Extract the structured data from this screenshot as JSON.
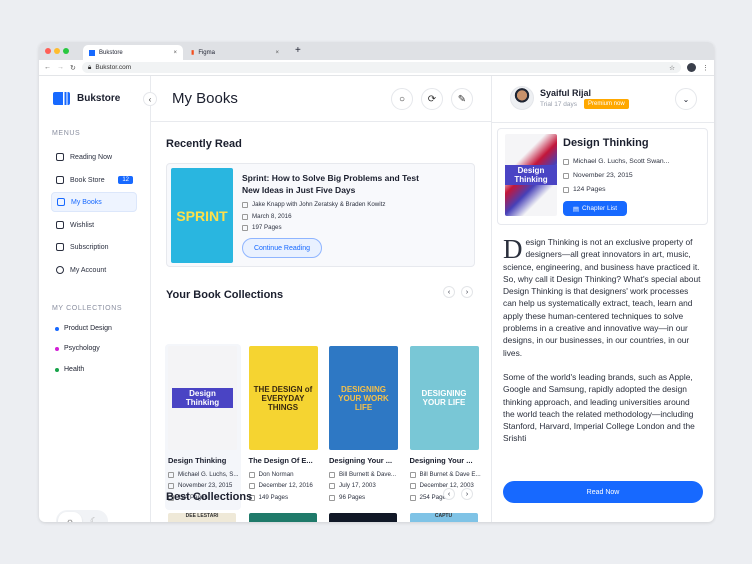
{
  "browser": {
    "tabs": [
      {
        "label": "Bukstore"
      },
      {
        "label": "Figma"
      }
    ],
    "url": "Bukstor.com"
  },
  "brand": "Bukstore",
  "sidebar": {
    "menus_heading": "MENUS",
    "items": [
      {
        "label": "Reading Now"
      },
      {
        "label": "Book Store",
        "badge": "12"
      },
      {
        "label": "My Books"
      },
      {
        "label": "Wishlist"
      },
      {
        "label": "Subscription"
      },
      {
        "label": "My Account"
      }
    ],
    "collections_heading": "MY COLLECTIONS",
    "collections": [
      {
        "label": "Product Design",
        "color": "#1769ff"
      },
      {
        "label": "Psychology",
        "color": "#d21fd6"
      },
      {
        "label": "Health",
        "color": "#18a34a"
      }
    ]
  },
  "header": {
    "title": "My Books"
  },
  "user": {
    "name": "Syaiful Rijal",
    "trial": "Trial 17 days",
    "premium": "Premium now"
  },
  "recent": {
    "heading": "Recently Read",
    "title": "Sprint: How to Solve Big Problems and Test New Ideas in Just Five Days",
    "authors": "Jake Knapp with John Zeratsky & Braden Kowitz",
    "date": "March 8, 2016",
    "pages": "197 Pages",
    "button": "Continue Reading",
    "cover_text": "SPRINT"
  },
  "collections": {
    "heading": "Your Book Collections",
    "books": [
      {
        "title": "Design Thinking",
        "author": "Michael G. Luchs, S...",
        "date": "November 23, 2015",
        "pages": "124 Pages",
        "cover_text": "Design Thinking",
        "cover_bg": "#f4f4f6",
        "cover_fg": "#ffffff"
      },
      {
        "title": "The Design Of E...",
        "author": "Don Norman",
        "date": "December 12, 2016",
        "pages": "149 Pages",
        "cover_text": "THE DESIGN of EVERYDAY THINGS",
        "cover_bg": "#f5d431",
        "cover_fg": "#3a2a10"
      },
      {
        "title": "Designing Your ...",
        "author": "Bill Burnett & Dave...",
        "date": "July 17, 2003",
        "pages": "96 Pages",
        "cover_text": "DESIGNING YOUR WORK LIFE",
        "cover_bg": "#2e78c4",
        "cover_fg": "#f4c04a"
      },
      {
        "title": "Designing Your ...",
        "author": "Bill Burnet & Dave E...",
        "date": "December 12, 2003",
        "pages": "254 Pages",
        "cover_text": "DESIGNING YOUR LIFE",
        "cover_bg": "#79c7d6",
        "cover_fg": "#ffffff"
      }
    ]
  },
  "best": {
    "heading": "Best Collections",
    "covers": [
      {
        "text": "DEE LESTARI",
        "bg": "#efe9d8"
      },
      {
        "text": "",
        "bg": "#1f7a6a"
      },
      {
        "text": "",
        "bg": "#111827"
      },
      {
        "text": "CAPTU",
        "bg": "#7fc3e6"
      }
    ]
  },
  "detail": {
    "title": "Design Thinking",
    "author": "Michael G. Luchs, Scott Swan...",
    "date": "November 23, 2015",
    "pages": "124 Pages",
    "button": "Chapter List",
    "drop_cap": "D",
    "paragraph1": "esign Thinking is not an exclusive property of designers—all great innovators in art, music, science, engineering, and business have practiced it. So, why call it Design Thinking? What's special about Design Thinking is that designers' work processes can help us systematically extract, teach, learn and apply these human-centered techniques to solve problems in a creative and innovative way—in our designs, in our businesses, in our countries, in our lives.",
    "paragraph2": "Some of the world's leading brands, such as Apple, Google and Samsung, rapidly adopted the design thinking approach, and leading universities around the world teach the related methodology—including Stanford, Harvard, Imperial College London and the Srishti",
    "read_button": "Read Now"
  }
}
